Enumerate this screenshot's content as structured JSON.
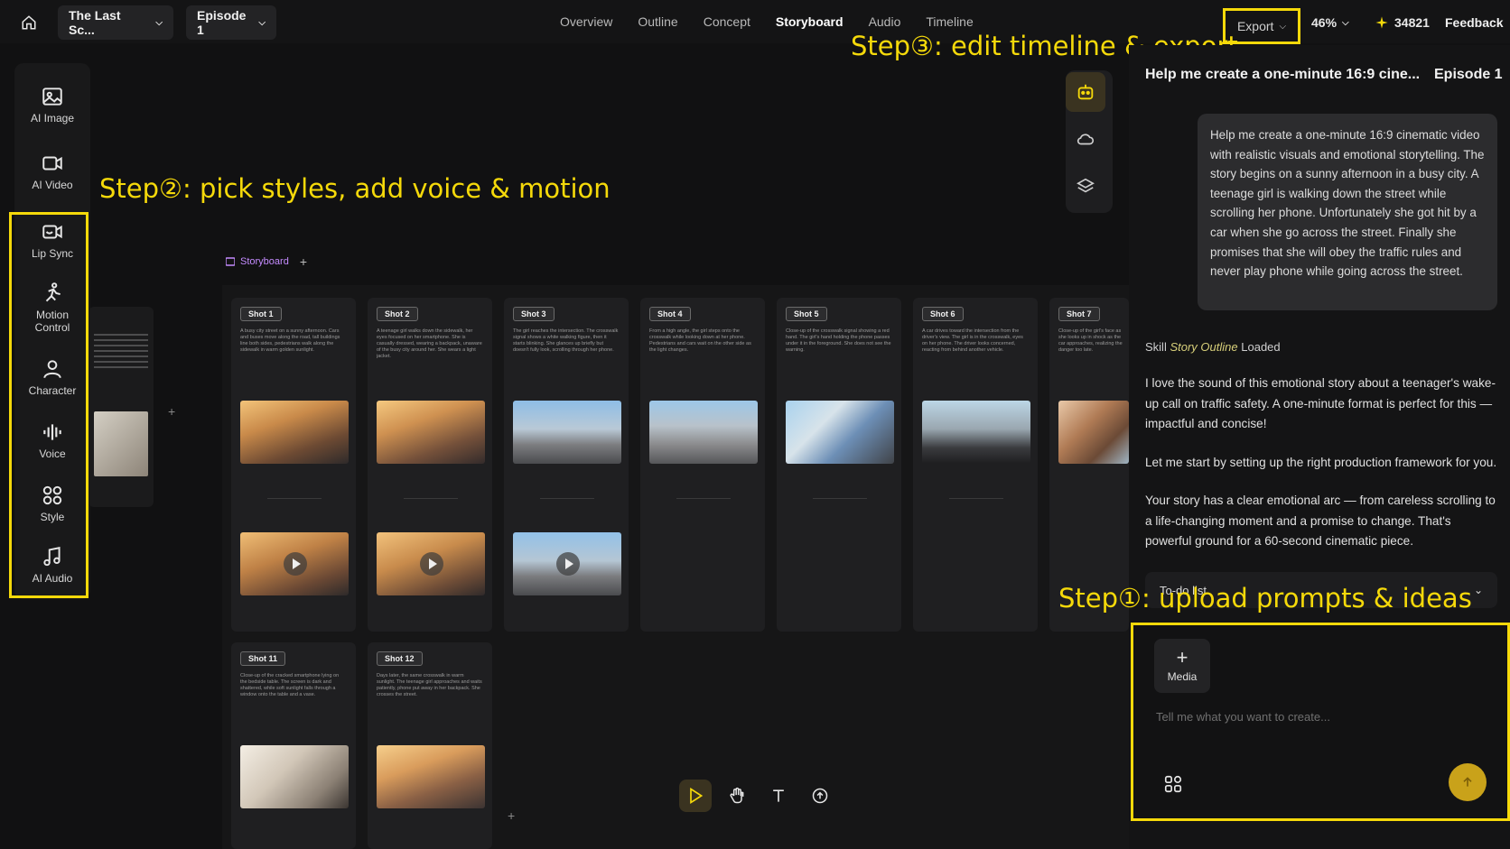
{
  "topbar": {
    "project_title": "The Last Sc...",
    "episode": "Episode 1",
    "nav": [
      "Overview",
      "Outline",
      "Concept",
      "Storyboard",
      "Audio",
      "Timeline"
    ],
    "active_nav": "Storyboard",
    "export_label": "Export",
    "zoom": "46%",
    "credits": "34821",
    "feedback_label": "Feedback"
  },
  "annotations": {
    "step1": "Step①: upload prompts & ideas",
    "step2": "Step②: pick styles, add voice & motion",
    "step3": "Step③: edit timeline & export",
    "highlight_color": "#f5d90a"
  },
  "left_tools": [
    {
      "label": "AI Image",
      "icon": "image-icon"
    },
    {
      "label": "AI Video",
      "icon": "video-icon"
    },
    {
      "label": "Lip Sync",
      "icon": "lip-sync-icon"
    },
    {
      "label": "Motion Control",
      "icon": "motion-icon"
    },
    {
      "label": "Character",
      "icon": "character-icon"
    },
    {
      "label": "Voice",
      "icon": "voice-icon"
    },
    {
      "label": "Style",
      "icon": "style-icon"
    },
    {
      "label": "AI Audio",
      "icon": "music-icon"
    }
  ],
  "storyboard": {
    "tab_label": "Storyboard",
    "shots": [
      {
        "label": "Shot 1",
        "desc": "A busy city street on a sunny afternoon. Cars and buses move along the road, tall buildings line both sides, pedestrians walk along the sidewalk in warm golden sunlight."
      },
      {
        "label": "Shot 2",
        "desc": "A teenage girl walks down the sidewalk, her eyes focused on her smartphone. She is casually dressed, wearing a backpack, unaware of the busy city around her. She wears a light jacket."
      },
      {
        "label": "Shot 3",
        "desc": "The girl reaches the intersection. The crosswalk signal shows a white walking figure, then it starts blinking. She glances up briefly but doesn't fully look, scrolling through her phone."
      },
      {
        "label": "Shot 4",
        "desc": "From a high angle, the girl steps onto the crosswalk while looking down at her phone. Pedestrians and cars wait on the other side as the light changes."
      },
      {
        "label": "Shot 5",
        "desc": "Close-up of the crosswalk signal showing a red hand. The girl's hand holding the phone passes under it in the foreground. She does not see the warning."
      },
      {
        "label": "Shot 6",
        "desc": "A car drives toward the intersection from the driver's view. The girl is in the crosswalk, eyes on her phone. The driver looks concerned, reacting from behind another vehicle."
      },
      {
        "label": "Shot 7",
        "desc": "Close-up of the girl's face as she looks up in shock as the car approaches, realizing the danger too late."
      },
      {
        "label": "Shot 11",
        "desc": "Close-up of the cracked smartphone lying on the bedside table. The screen is dark and shattered, while soft sunlight falls through a window onto the table and a vase."
      },
      {
        "label": "Shot 12",
        "desc": "Days later, the same crosswalk in warm sunlight. The teenage girl approaches and waits patiently, phone put away in her backpack. She crosses the street."
      }
    ]
  },
  "bottom_tools": [
    "select-tool",
    "hand-tool",
    "text-tool",
    "upload-tool"
  ],
  "chat": {
    "title": "Help me create a one-minute 16:9 cine...",
    "episode": "Episode 1",
    "user_prompt": "Help me create a one-minute 16:9 cinematic video with realistic visuals and emotional storytelling. The story begins on a sunny afternoon in a busy city. A teenage girl is walking down the street while scrolling her phone. Unfortunately she got hit by a car when she go across the street. Finally she promises that she will obey the traffic rules and never play phone while going across the street.",
    "skill_prefix": "Skill",
    "skill_name": "Story Outline",
    "skill_suffix": "Loaded",
    "messages": [
      "I love the sound of this emotional story about a teenager's wake-up call on traffic safety. A one-minute format is perfect for this — impactful and concise!",
      "Let me start by setting up the right production framework for you.",
      "Your story has a clear emotional arc — from careless scrolling to a life-changing moment and a promise to change. That's powerful ground for a 60-second cinematic piece."
    ],
    "todo_label": "To-do list",
    "media_label": "Media",
    "input_placeholder": "Tell me what you want to create..."
  }
}
